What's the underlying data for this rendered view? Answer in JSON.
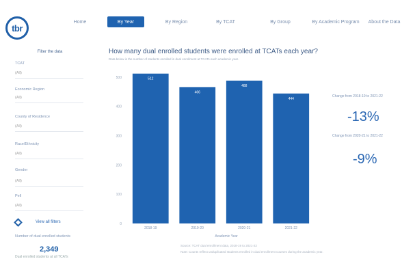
{
  "header": {
    "logo_text": "tbr",
    "tabs": [
      {
        "label": "Home",
        "active": false
      },
      {
        "label": "By Year",
        "active": true
      },
      {
        "label": "By Region",
        "active": false
      },
      {
        "label": "By TCAT",
        "active": false
      },
      {
        "label": "By Group",
        "active": false
      },
      {
        "label": "By Academic Program",
        "active": false
      },
      {
        "label": "About the Data",
        "active": false
      }
    ]
  },
  "sidebar": {
    "title": "Filter the data",
    "filters": [
      {
        "label": "TCAT",
        "value": "(All)"
      },
      {
        "label": "Economic Region",
        "value": "(All)"
      },
      {
        "label": "County of Residence",
        "value": "(All)"
      },
      {
        "label": "Race/Ethnicity",
        "value": "(All)"
      },
      {
        "label": "Gender",
        "value": "(All)"
      },
      {
        "label": "Pell",
        "value": "(All)"
      }
    ],
    "view_link": "View all filters",
    "total_label": "Number of dual enrolled students",
    "total_value": "2,349",
    "total_sub": "Dual enrolled students at all TCATs"
  },
  "chart_data": {
    "type": "bar",
    "title": "How many dual enrolled students were enrolled at TCATs each year?",
    "subtitle": "Data below is the number of students enrolled in dual enrollment at TCATs each academic year.",
    "categories": [
      "2018-19",
      "2019-20",
      "2020-21",
      "2021-22"
    ],
    "values": [
      512,
      466,
      488,
      444
    ],
    "value_labels": [
      "512",
      "466",
      "488",
      "444"
    ],
    "xlabel": "Academic Year",
    "ylabel": "",
    "ylim": [
      0,
      530
    ],
    "yticks": [
      0,
      100,
      200,
      300,
      400,
      500
    ],
    "ytick_labels": [
      "0",
      "100",
      "200",
      "300",
      "400",
      "500"
    ],
    "grid": false,
    "bar_color": "#1f63b0"
  },
  "footnotes": [
    "Source: TCAT dual enrollment data, 2018-19 to 2021-22",
    "Note: Counts reflect unduplicated students enrolled in dual enrollment courses during the academic year."
  ],
  "kpis": [
    {
      "label": "Change from 2018-19 to 2021-22",
      "value": "-13%"
    },
    {
      "label": "Change from 2020-21 to 2021-22",
      "value": "-9%"
    }
  ],
  "colors": {
    "accent": "#1f63b0",
    "title": "#3c5a85",
    "kpi": "#2a67b3"
  }
}
